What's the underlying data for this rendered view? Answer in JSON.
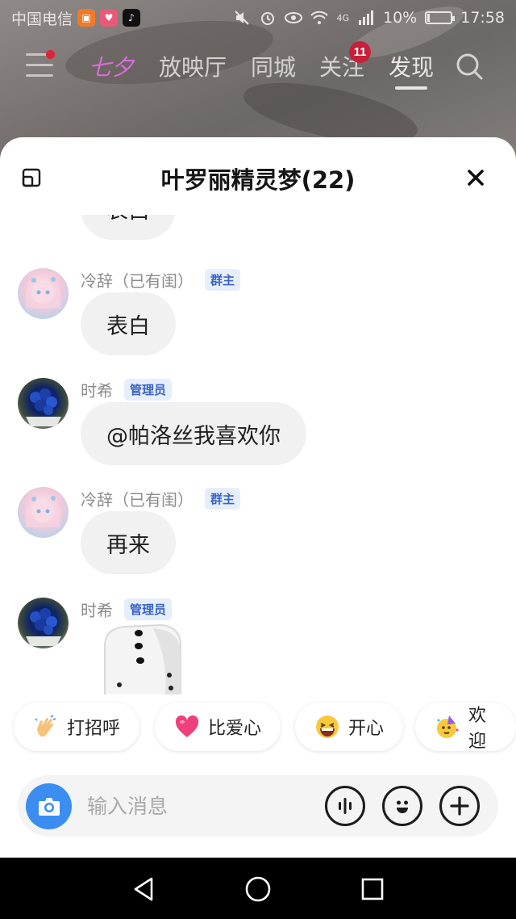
{
  "status_bar": {
    "carrier": "中国电信",
    "network": "4G",
    "battery": "10%",
    "time": "17:58"
  },
  "top_nav": {
    "tabs": [
      {
        "label": "七夕",
        "style": "festive"
      },
      {
        "label": "放映厅"
      },
      {
        "label": "同城"
      },
      {
        "label": "关注",
        "badge": "11"
      },
      {
        "label": "发现",
        "active": true
      }
    ]
  },
  "panel": {
    "title": "叶罗丽精灵梦(22)"
  },
  "messages": [
    {
      "type": "text",
      "text": "表白",
      "partial": true
    },
    {
      "sender": "冷辞（已有闺）",
      "role": "群主",
      "avatar": "anime-girl",
      "type": "text",
      "text": "表白"
    },
    {
      "sender": "时希",
      "role": "管理员",
      "avatar": "blue-roses",
      "type": "text",
      "text": "@帕洛丝我喜欢你"
    },
    {
      "sender": "冷辞（已有闺）",
      "role": "群主",
      "avatar": "anime-girl",
      "type": "text",
      "text": "再来"
    },
    {
      "sender": "时希",
      "role": "管理员",
      "avatar": "blue-roses",
      "type": "dice",
      "dice_face": 3
    }
  ],
  "quick_replies": [
    {
      "label": "打招呼",
      "icon": "waving-hand-icon"
    },
    {
      "label": "比爱心",
      "icon": "heart-icon"
    },
    {
      "label": "开心",
      "icon": "laughing-face-icon"
    },
    {
      "label": "欢迎",
      "icon": "party-face-icon"
    }
  ],
  "input": {
    "placeholder": "输入消息"
  },
  "colors": {
    "accent_blue": "#3b8df2",
    "badge_red": "#c5213a",
    "role_badge_text": "#3a63c7",
    "role_badge_bg": "#e6eefb",
    "bubble_bg": "#f1f1f1"
  }
}
